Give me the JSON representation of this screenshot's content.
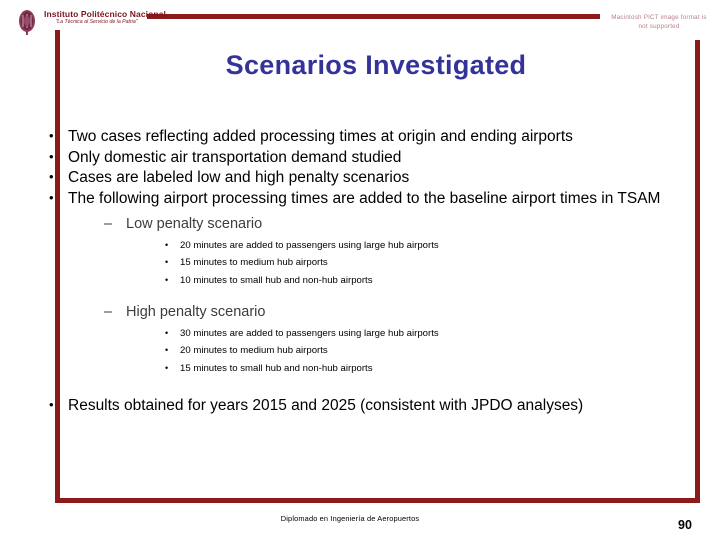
{
  "colors": {
    "frame": "#8C1A1A",
    "title": "#333399",
    "logo": "#7A1520",
    "placeholder": "#B9808A"
  },
  "header": {
    "logo_name": "Instituto Politécnico Nacional",
    "logo_tagline": "\"La Técnica al Servicio de la Patria\"",
    "pict_placeholder": "Macintosh PICT image format is not supported"
  },
  "title": "Scenarios Investigated",
  "bullets": [
    {
      "text": "Two cases reflecting added processing times at origin and ending airports"
    },
    {
      "text": "Only domestic air transportation demand studied"
    },
    {
      "text": "Cases are labeled low and high penalty scenarios"
    },
    {
      "text": "The following airport processing times are added to the baseline airport times in TSAM"
    }
  ],
  "scenarios": [
    {
      "label": "Low penalty scenario",
      "items": [
        "20 minutes are added to passengers using large hub airports",
        "15 minutes to medium hub airports",
        "10 minutes to small hub and non-hub airports"
      ]
    },
    {
      "label": "High penalty scenario",
      "items": [
        "30 minutes are added to passengers using large hub airports",
        "20 minutes to medium hub airports",
        "15 minutes to small hub and non-hub airports"
      ]
    }
  ],
  "final_bullet": "Results obtained for years 2015 and 2025 (consistent with JPDO analyses)",
  "footer": {
    "text": "Diplomado en Ingeniería de Aeropuertos",
    "page_number": "90"
  },
  "glyphs": {
    "bullet1": "•",
    "bullet2": "–",
    "bullet3": "•"
  }
}
